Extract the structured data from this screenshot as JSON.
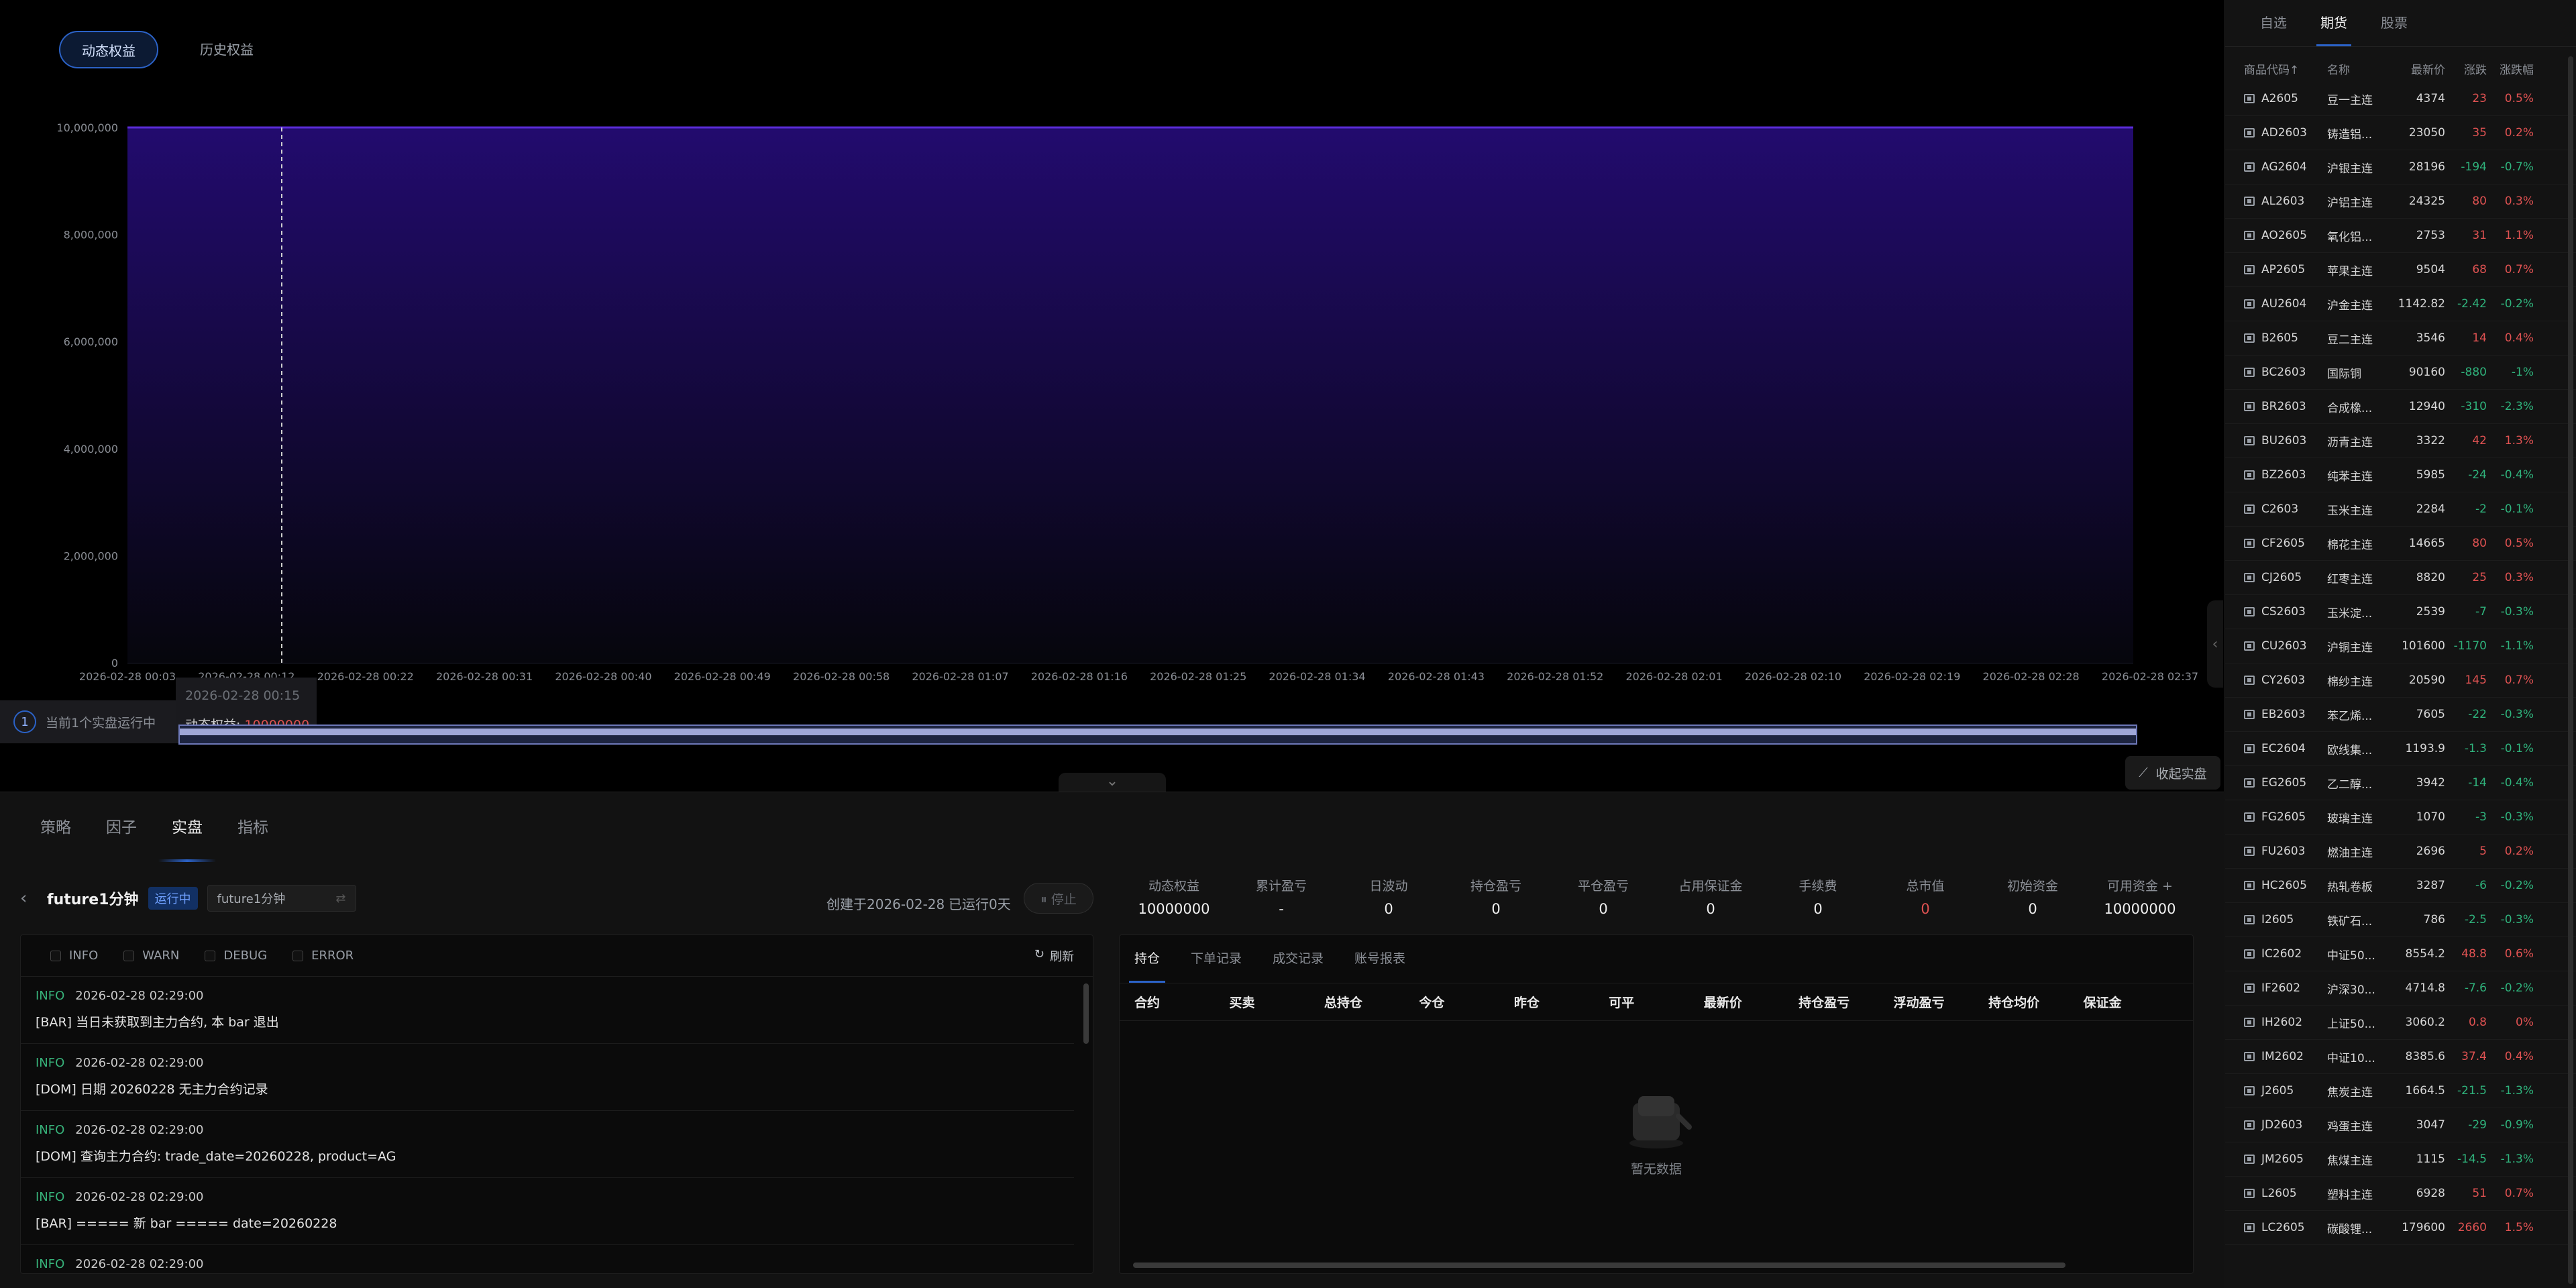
{
  "equity_tabs": [
    "动态权益",
    "历史权益"
  ],
  "chart_data": {
    "type": "area",
    "title": "",
    "series": [
      {
        "name": "动态权益",
        "values": [
          10000000,
          10000000
        ]
      }
    ],
    "x": [
      "2026-02-28 00:03",
      "2026-02-28 02:37"
    ],
    "x_ticks": [
      "2026-02-28 00:03",
      "2026-02-28 00:12",
      "2026-02-28 00:22",
      "2026-02-28 00:31",
      "2026-02-28 00:40",
      "2026-02-28 00:49",
      "2026-02-28 00:58",
      "2026-02-28 01:07",
      "2026-02-28 01:16",
      "2026-02-28 01:25",
      "2026-02-28 01:34",
      "2026-02-28 01:43",
      "2026-02-28 01:52",
      "2026-02-28 02:01",
      "2026-02-28 02:10",
      "2026-02-28 02:19",
      "2026-02-28 02:28",
      "2026-02-28 02:37"
    ],
    "y_ticks": [
      "0",
      "2,000,000",
      "4,000,000",
      "6,000,000",
      "8,000,000",
      "10,000,000"
    ],
    "ylim": [
      0,
      10000000
    ],
    "grid": true,
    "colors": {
      "line": "#5a2bd6",
      "fill_top": "#220b6e",
      "fill_bottom": "#06060c"
    }
  },
  "tooltip": {
    "time": "2026-02-28 00:15",
    "label": "动态权益: ",
    "value": "10000000"
  },
  "running": {
    "count": "1",
    "text": "当前1个实盘运行中"
  },
  "collapse_label": "收起实盘",
  "section_tabs": [
    "策略",
    "因子",
    "实盘",
    "指标"
  ],
  "strategy": {
    "name": "future1分钟",
    "status": "运行中",
    "select_value": "future1分钟",
    "created": "创建于2026-02-28",
    "running_days": "已运行0天",
    "stop_label": "⏸ 停止"
  },
  "stats": [
    {
      "label": "动态权益",
      "value": "10000000",
      "red": false
    },
    {
      "label": "累计盈亏",
      "value": "-",
      "red": false
    },
    {
      "label": "日波动",
      "value": "0",
      "red": false
    },
    {
      "label": "持仓盈亏",
      "value": "0",
      "red": false
    },
    {
      "label": "平仓盈亏",
      "value": "0",
      "red": false
    },
    {
      "label": "占用保证金",
      "value": "0",
      "red": false
    },
    {
      "label": "手续费",
      "value": "0",
      "red": false
    },
    {
      "label": "总市值",
      "value": "0",
      "red": true
    },
    {
      "label": "初始资金",
      "value": "0",
      "red": false
    },
    {
      "label": "可用资金 +",
      "value": "10000000",
      "red": false
    }
  ],
  "log": {
    "filters": [
      "INFO",
      "WARN",
      "DEBUG",
      "ERROR"
    ],
    "refresh_label": "刷新",
    "items": [
      {
        "level": "INFO",
        "time": "2026-02-28 02:29:00",
        "msg": "[BAR] 当日未获取到主力合约, 本 bar 退出"
      },
      {
        "level": "INFO",
        "time": "2026-02-28 02:29:00",
        "msg": "[DOM] 日期 20260228 无主力合约记录"
      },
      {
        "level": "INFO",
        "time": "2026-02-28 02:29:00",
        "msg": "[DOM] 查询主力合约: trade_date=20260228, product=AG"
      },
      {
        "level": "INFO",
        "time": "2026-02-28 02:29:00",
        "msg": "[BAR] ===== 新 bar ===== date=20260228"
      },
      {
        "level": "INFO",
        "time": "2026-02-28 02:29:00",
        "msg": ""
      }
    ]
  },
  "positions": {
    "tabs": [
      "持仓",
      "下单记录",
      "成交记录",
      "账号报表"
    ],
    "columns": [
      "合约",
      "买卖",
      "总持仓",
      "今仓",
      "昨仓",
      "可平",
      "最新价",
      "持仓盈亏",
      "浮动盈亏",
      "持仓均价",
      "保证金"
    ],
    "empty_text": "暂无数据"
  },
  "watchlist": {
    "tabs": [
      "自选",
      "期货",
      "股票"
    ],
    "headers": {
      "code": "商品代码↑",
      "name": "名称",
      "price": "最新价",
      "chg": "涨跌",
      "pct": "涨跌幅"
    },
    "rows": [
      {
        "code": "A2605",
        "name": "豆一主连",
        "price": "4374",
        "chg": "23",
        "pct": "0.5%",
        "dir": "up"
      },
      {
        "code": "AD2603",
        "name": "铸造铝...",
        "price": "23050",
        "chg": "35",
        "pct": "0.2%",
        "dir": "up"
      },
      {
        "code": "AG2604",
        "name": "沪银主连",
        "price": "28196",
        "chg": "-194",
        "pct": "-0.7%",
        "dir": "down"
      },
      {
        "code": "AL2603",
        "name": "沪铝主连",
        "price": "24325",
        "chg": "80",
        "pct": "0.3%",
        "dir": "up"
      },
      {
        "code": "AO2605",
        "name": "氧化铝...",
        "price": "2753",
        "chg": "31",
        "pct": "1.1%",
        "dir": "up"
      },
      {
        "code": "AP2605",
        "name": "苹果主连",
        "price": "9504",
        "chg": "68",
        "pct": "0.7%",
        "dir": "up"
      },
      {
        "code": "AU2604",
        "name": "沪金主连",
        "price": "1142.82",
        "chg": "-2.42",
        "pct": "-0.2%",
        "dir": "down"
      },
      {
        "code": "B2605",
        "name": "豆二主连",
        "price": "3546",
        "chg": "14",
        "pct": "0.4%",
        "dir": "up"
      },
      {
        "code": "BC2603",
        "name": "国际铜",
        "price": "90160",
        "chg": "-880",
        "pct": "-1%",
        "dir": "down"
      },
      {
        "code": "BR2603",
        "name": "合成橡...",
        "price": "12940",
        "chg": "-310",
        "pct": "-2.3%",
        "dir": "down"
      },
      {
        "code": "BU2603",
        "name": "沥青主连",
        "price": "3322",
        "chg": "42",
        "pct": "1.3%",
        "dir": "up"
      },
      {
        "code": "BZ2603",
        "name": "纯苯主连",
        "price": "5985",
        "chg": "-24",
        "pct": "-0.4%",
        "dir": "down"
      },
      {
        "code": "C2603",
        "name": "玉米主连",
        "price": "2284",
        "chg": "-2",
        "pct": "-0.1%",
        "dir": "down"
      },
      {
        "code": "CF2605",
        "name": "棉花主连",
        "price": "14665",
        "chg": "80",
        "pct": "0.5%",
        "dir": "up"
      },
      {
        "code": "CJ2605",
        "name": "红枣主连",
        "price": "8820",
        "chg": "25",
        "pct": "0.3%",
        "dir": "up"
      },
      {
        "code": "CS2603",
        "name": "玉米淀...",
        "price": "2539",
        "chg": "-7",
        "pct": "-0.3%",
        "dir": "down"
      },
      {
        "code": "CU2603",
        "name": "沪铜主连",
        "price": "101600",
        "chg": "-1170",
        "pct": "-1.1%",
        "dir": "down"
      },
      {
        "code": "CY2603",
        "name": "棉纱主连",
        "price": "20590",
        "chg": "145",
        "pct": "0.7%",
        "dir": "up"
      },
      {
        "code": "EB2603",
        "name": "苯乙烯...",
        "price": "7605",
        "chg": "-22",
        "pct": "-0.3%",
        "dir": "down"
      },
      {
        "code": "EC2604",
        "name": "欧线集...",
        "price": "1193.9",
        "chg": "-1.3",
        "pct": "-0.1%",
        "dir": "down"
      },
      {
        "code": "EG2605",
        "name": "乙二醇...",
        "price": "3942",
        "chg": "-14",
        "pct": "-0.4%",
        "dir": "down"
      },
      {
        "code": "FG2605",
        "name": "玻璃主连",
        "price": "1070",
        "chg": "-3",
        "pct": "-0.3%",
        "dir": "down"
      },
      {
        "code": "FU2603",
        "name": "燃油主连",
        "price": "2696",
        "chg": "5",
        "pct": "0.2%",
        "dir": "up"
      },
      {
        "code": "HC2605",
        "name": "热轧卷板",
        "price": "3287",
        "chg": "-6",
        "pct": "-0.2%",
        "dir": "down"
      },
      {
        "code": "I2605",
        "name": "铁矿石...",
        "price": "786",
        "chg": "-2.5",
        "pct": "-0.3%",
        "dir": "down"
      },
      {
        "code": "IC2602",
        "name": "中证50...",
        "price": "8554.2",
        "chg": "48.8",
        "pct": "0.6%",
        "dir": "up"
      },
      {
        "code": "IF2602",
        "name": "沪深30...",
        "price": "4714.8",
        "chg": "-7.6",
        "pct": "-0.2%",
        "dir": "down"
      },
      {
        "code": "IH2602",
        "name": "上证50...",
        "price": "3060.2",
        "chg": "0.8",
        "pct": "0%",
        "dir": "up"
      },
      {
        "code": "IM2602",
        "name": "中证10...",
        "price": "8385.6",
        "chg": "37.4",
        "pct": "0.4%",
        "dir": "up"
      },
      {
        "code": "J2605",
        "name": "焦炭主连",
        "price": "1664.5",
        "chg": "-21.5",
        "pct": "-1.3%",
        "dir": "down"
      },
      {
        "code": "JD2603",
        "name": "鸡蛋主连",
        "price": "3047",
        "chg": "-29",
        "pct": "-0.9%",
        "dir": "down"
      },
      {
        "code": "JM2605",
        "name": "焦煤主连",
        "price": "1115",
        "chg": "-14.5",
        "pct": "-1.3%",
        "dir": "down"
      },
      {
        "code": "L2605",
        "name": "塑料主连",
        "price": "6928",
        "chg": "51",
        "pct": "0.7%",
        "dir": "up"
      },
      {
        "code": "LC2605",
        "name": "碳酸锂...",
        "price": "179600",
        "chg": "2660",
        "pct": "1.5%",
        "dir": "up"
      }
    ]
  }
}
